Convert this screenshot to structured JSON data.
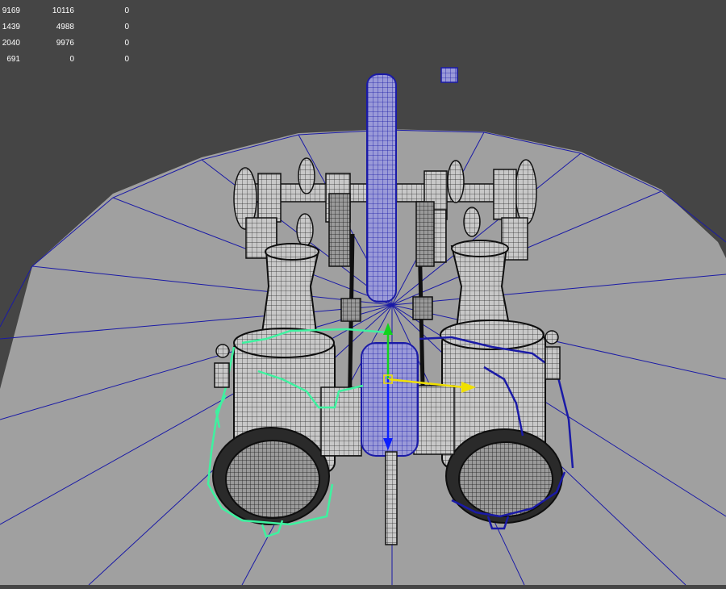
{
  "hud": {
    "rows": [
      [
        "9169",
        "10116",
        "0"
      ],
      [
        "1439",
        "4988",
        "0"
      ],
      [
        "2040",
        "9976",
        "0"
      ],
      [
        "691",
        "0",
        "0"
      ]
    ]
  },
  "colors": {
    "background": "#454545",
    "ground": "#a0a0a0",
    "wire_dark": "#101010",
    "selection_blue": "#1a1aa6",
    "selection_green": "#3ef2a0",
    "gizmo_yellow": "#f0e000",
    "gizmo_green": "#12d21e"
  }
}
